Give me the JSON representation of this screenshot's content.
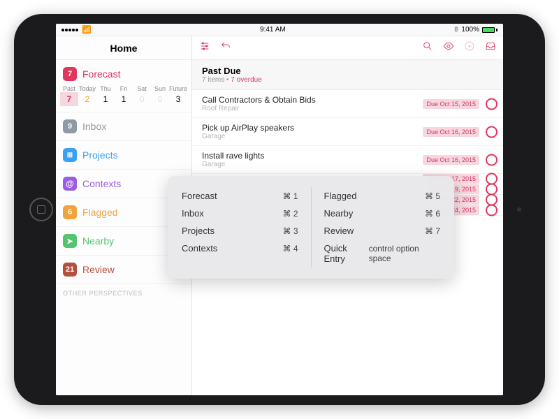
{
  "status": {
    "time": "9:41 AM",
    "battery": "100%"
  },
  "sidebar": {
    "title": "Home",
    "forecast": {
      "label": "Forecast",
      "count": "7",
      "days": [
        "Past",
        "Today",
        "Thu",
        "Fri",
        "Sat",
        "Sun",
        "Future"
      ],
      "nums": [
        "7",
        "2",
        "1",
        "1",
        "0",
        "0",
        "3"
      ]
    },
    "items": [
      {
        "label": "Inbox",
        "count": "9",
        "color": "#8e9aa6"
      },
      {
        "label": "Projects",
        "count": "",
        "color": "#3aa0f2",
        "icon": "grid"
      },
      {
        "label": "Contexts",
        "count": "",
        "color": "#9a5fe0",
        "icon": "at"
      },
      {
        "label": "Flagged",
        "count": "6",
        "color": "#f2a23a"
      },
      {
        "label": "Nearby",
        "count": "",
        "color": "#55c46f",
        "icon": "loc"
      },
      {
        "label": "Review",
        "count": "21",
        "color": "#b5503d"
      }
    ],
    "other_label": "OTHER PERSPECTIVES"
  },
  "detail": {
    "header": {
      "title": "Past Due",
      "sub_count": "7 items",
      "sub_overdue": "7 overdue"
    },
    "tasks": [
      {
        "t": "Call Contractors & Obtain Bids",
        "p": "Roof Repair",
        "due": "Due Oct 15, 2015"
      },
      {
        "t": "Pick up AirPlay speakers",
        "p": "Garage",
        "due": "Due Oct 16, 2015"
      },
      {
        "t": "Install rave lights",
        "p": "Garage",
        "due": "Due Oct 16, 2015"
      },
      {
        "t": "",
        "p": "",
        "due": "Due Oct 17, 2015"
      },
      {
        "t": "",
        "p": "",
        "due": "Due Oct 19, 2015"
      },
      {
        "t": "",
        "p": "",
        "due": "Due Oct 22, 2015"
      },
      {
        "t": "",
        "p": "",
        "due": "Due Oct 24, 2015"
      }
    ]
  },
  "shortcuts": {
    "left": [
      {
        "name": "Forecast",
        "key": "⌘ 1"
      },
      {
        "name": "Inbox",
        "key": "⌘ 2"
      },
      {
        "name": "Projects",
        "key": "⌘ 3"
      },
      {
        "name": "Contexts",
        "key": "⌘ 4"
      }
    ],
    "right": [
      {
        "name": "Flagged",
        "key": "⌘ 5"
      },
      {
        "name": "Nearby",
        "key": "⌘ 6"
      },
      {
        "name": "Review",
        "key": "⌘ 7"
      },
      {
        "name": "Quick Entry",
        "key": "control option space"
      }
    ]
  }
}
